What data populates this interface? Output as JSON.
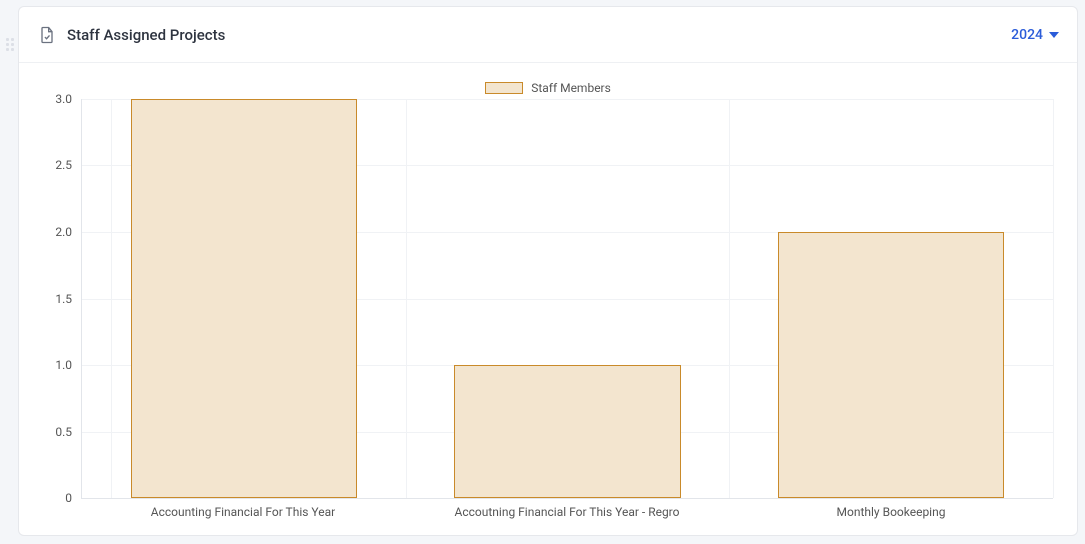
{
  "header": {
    "title": "Staff Assigned Projects",
    "year_label": "2024"
  },
  "legend": {
    "series_label": "Staff Members"
  },
  "chart_data": {
    "type": "bar",
    "title": "Staff Assigned Projects",
    "xlabel": "",
    "ylabel": "",
    "ylim": [
      0,
      3.0
    ],
    "yticks": [
      "0",
      "0.5",
      "1.0",
      "1.5",
      "2.0",
      "2.5",
      "3.0"
    ],
    "categories": [
      "Accounting Financial For This Year",
      "Accoutning Financial For This Year - Regro",
      "Monthly Bookeeping"
    ],
    "series": [
      {
        "name": "Staff Members",
        "values": [
          3,
          1,
          2
        ],
        "color_fill": "#f3e5cf",
        "color_border": "#c98a2a"
      }
    ],
    "legend_position": "top",
    "grid": true
  }
}
